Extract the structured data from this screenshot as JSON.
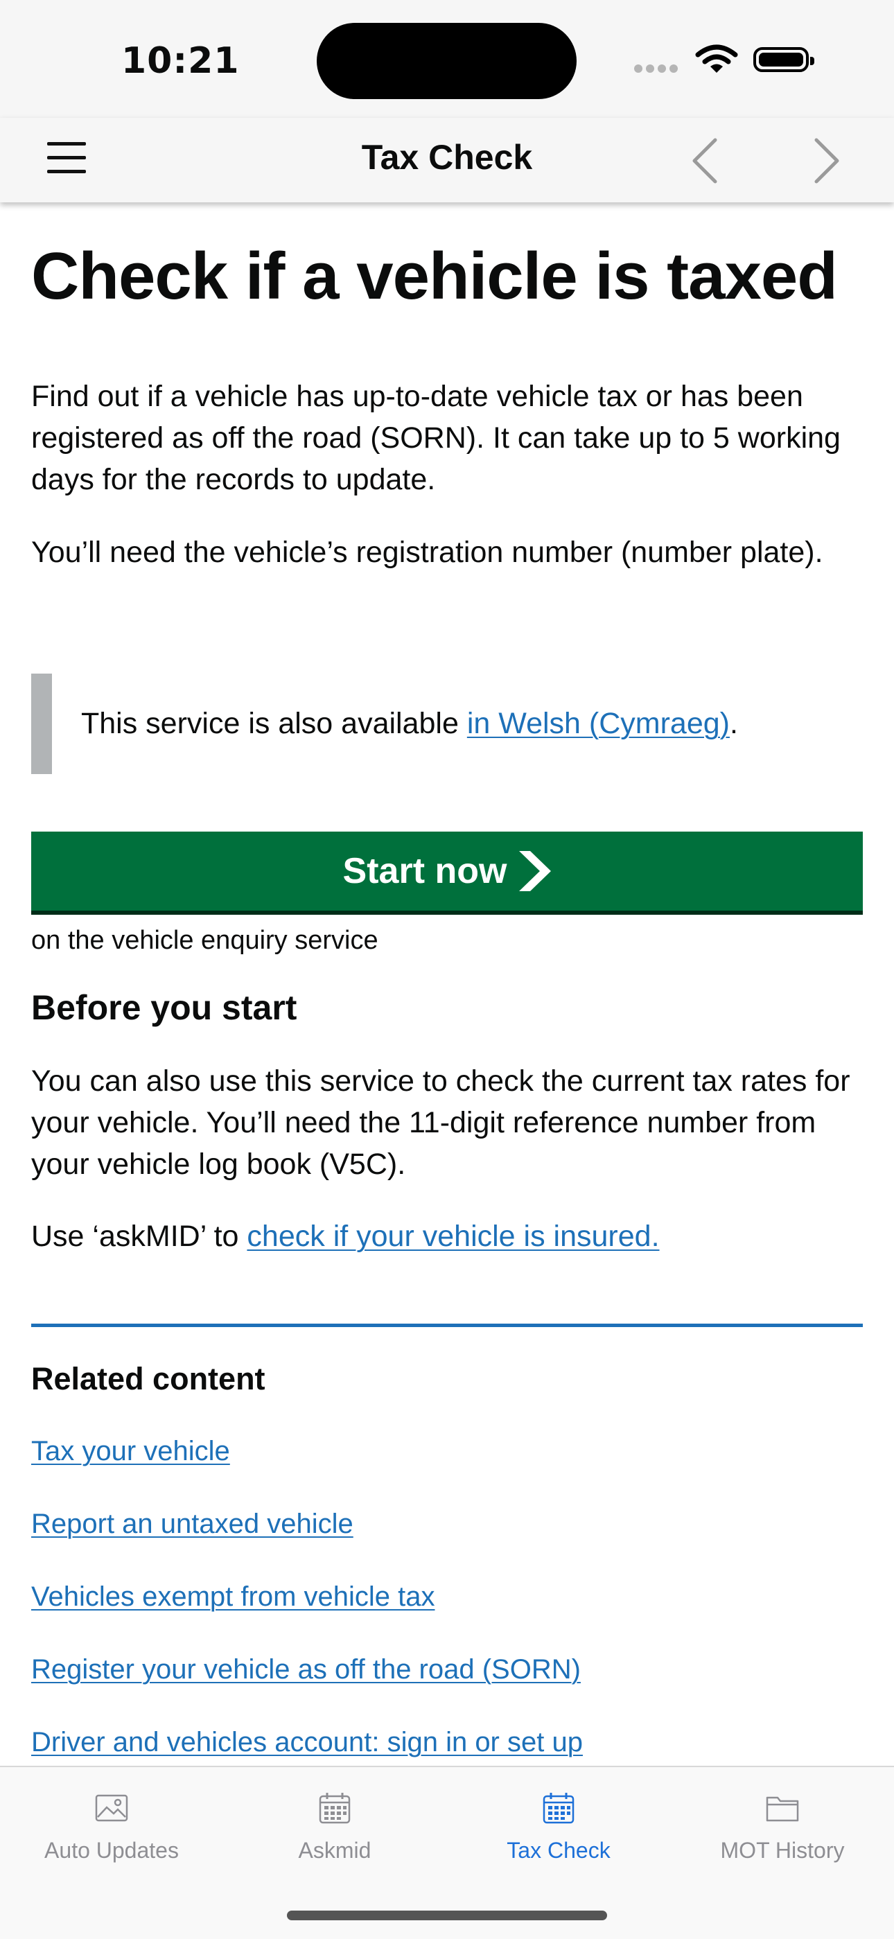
{
  "status": {
    "time": "10:21"
  },
  "nav": {
    "title": "Tax Check"
  },
  "page": {
    "heading": "Check if a vehicle is taxed",
    "intro": "Find out if a vehicle has up-to-date vehicle tax or has been registered as off the road (SORN). It can take up to 5 working days for the records to update.",
    "need": "You’ll need the vehicle’s registration number (number plate).",
    "inset_prefix": "This service is also available ",
    "inset_link": "in Welsh (Cymraeg)",
    "inset_suffix": ".",
    "start_button": "Start now",
    "start_note": "on the vehicle enquiry service",
    "before_heading": "Before you start",
    "before_text": "You can also use this service to check the current tax rates for your vehicle. You’ll need the 11-digit reference number from your vehicle log book (V5C).",
    "askmid_prefix": "Use ‘askMID’ to ",
    "askmid_link": "check if your vehicle is insured."
  },
  "related": {
    "heading": "Related content",
    "links": [
      "Tax your vehicle",
      "Report an untaxed vehicle",
      "Vehicles exempt from vehicle tax",
      "Register your vehicle as off the road (SORN)",
      "Driver and vehicles account: sign in or set up"
    ]
  },
  "tabs": [
    {
      "label": "Auto  Updates",
      "icon": "photo-icon",
      "active": false
    },
    {
      "label": "Askmid",
      "icon": "calendar-icon",
      "active": false
    },
    {
      "label": "Tax Check",
      "icon": "calendar-icon",
      "active": true
    },
    {
      "label": "MOT History",
      "icon": "folder-icon",
      "active": false
    }
  ],
  "colors": {
    "link": "#1d70b8",
    "start_button": "#00703c",
    "active_tab": "#1d70d8",
    "inactive_tab": "#8e8e93"
  }
}
